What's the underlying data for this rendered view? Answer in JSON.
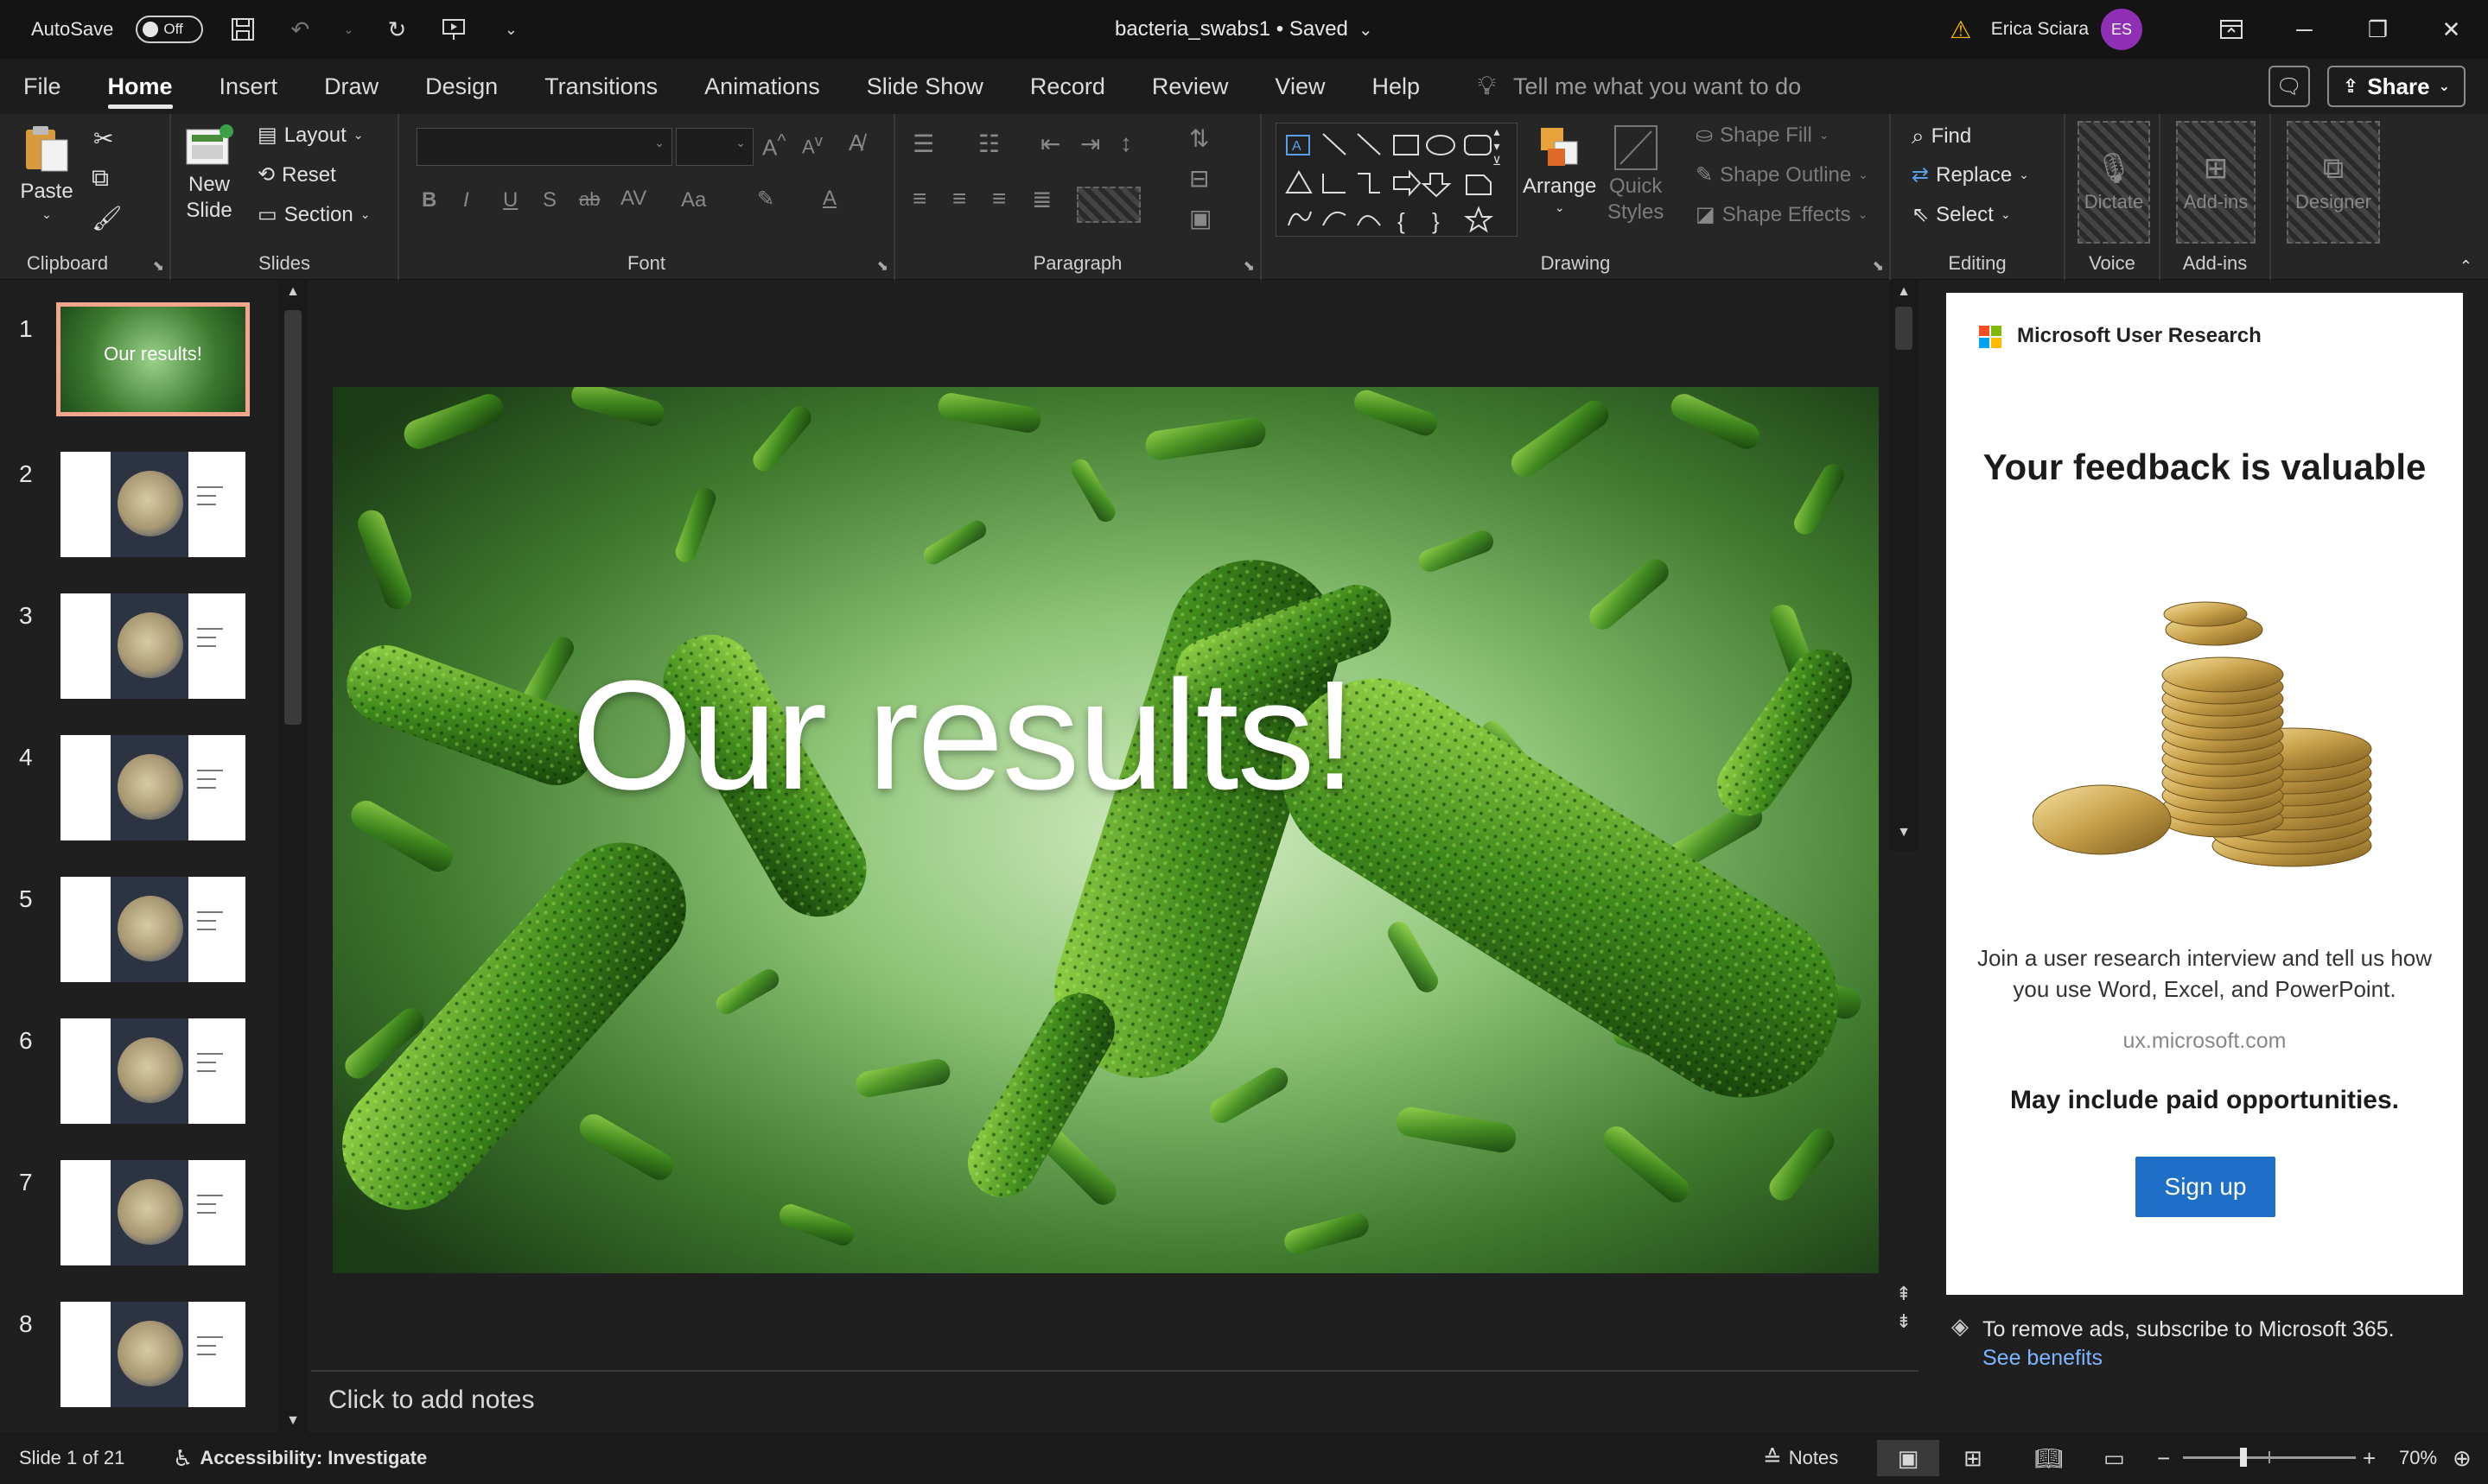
{
  "titlebar": {
    "autosave_label": "AutoSave",
    "autosave_state": "Off",
    "filename": "bacteria_swabs1 • Saved",
    "user_name": "Erica Sciara",
    "user_initials": "ES"
  },
  "menu": {
    "tabs": [
      "File",
      "Home",
      "Insert",
      "Draw",
      "Design",
      "Transitions",
      "Animations",
      "Slide Show",
      "Record",
      "Review",
      "View",
      "Help"
    ],
    "active_tab": "Home",
    "tell_me": "Tell me what you want to do",
    "share": "Share"
  },
  "ribbon": {
    "clipboard": {
      "paste": "Paste",
      "label": "Clipboard"
    },
    "slides": {
      "new_slide_1": "New",
      "new_slide_2": "Slide",
      "layout": "Layout",
      "reset": "Reset",
      "section": "Section",
      "label": "Slides"
    },
    "font": {
      "label": "Font"
    },
    "paragraph": {
      "label": "Paragraph"
    },
    "drawing": {
      "arrange": "Arrange",
      "quick_styles_1": "Quick",
      "quick_styles_2": "Styles",
      "shape_fill": "Shape Fill",
      "shape_outline": "Shape Outline",
      "shape_effects": "Shape Effects",
      "label": "Drawing"
    },
    "editing": {
      "find": "Find",
      "replace": "Replace",
      "select": "Select",
      "label": "Editing"
    },
    "voice": {
      "dictate": "Dictate",
      "label": "Voice"
    },
    "addins": {
      "addins": "Add-ins",
      "label": "Add-ins"
    },
    "designer": {
      "designer": "Designer"
    }
  },
  "thumbnails": {
    "numbers": [
      "1",
      "2",
      "3",
      "4",
      "5",
      "6",
      "7",
      "8"
    ],
    "slide1_title": "Our results!",
    "selected": "1"
  },
  "slide": {
    "title": "Our results!"
  },
  "notes": {
    "placeholder": "Click to add notes"
  },
  "ad": {
    "brand": "Microsoft User Research",
    "headline": "Your feedback is valuable",
    "body": "Join a user research interview and tell us how you use Word, Excel, and PowerPoint.",
    "url": "ux.microsoft.com",
    "paid": "May include paid opportunities.",
    "button": "Sign up",
    "remove_text": "To remove ads, subscribe to Microsoft 365.",
    "see_benefits": "See benefits"
  },
  "statusbar": {
    "slide_info": "Slide 1 of 21",
    "accessibility": "Accessibility: Investigate",
    "notes": "Notes",
    "zoom": "70%"
  },
  "colors": {
    "avatar": "#8e2fb5",
    "accent_selection": "#f4a58d",
    "ad_button": "#1f6fc9"
  }
}
